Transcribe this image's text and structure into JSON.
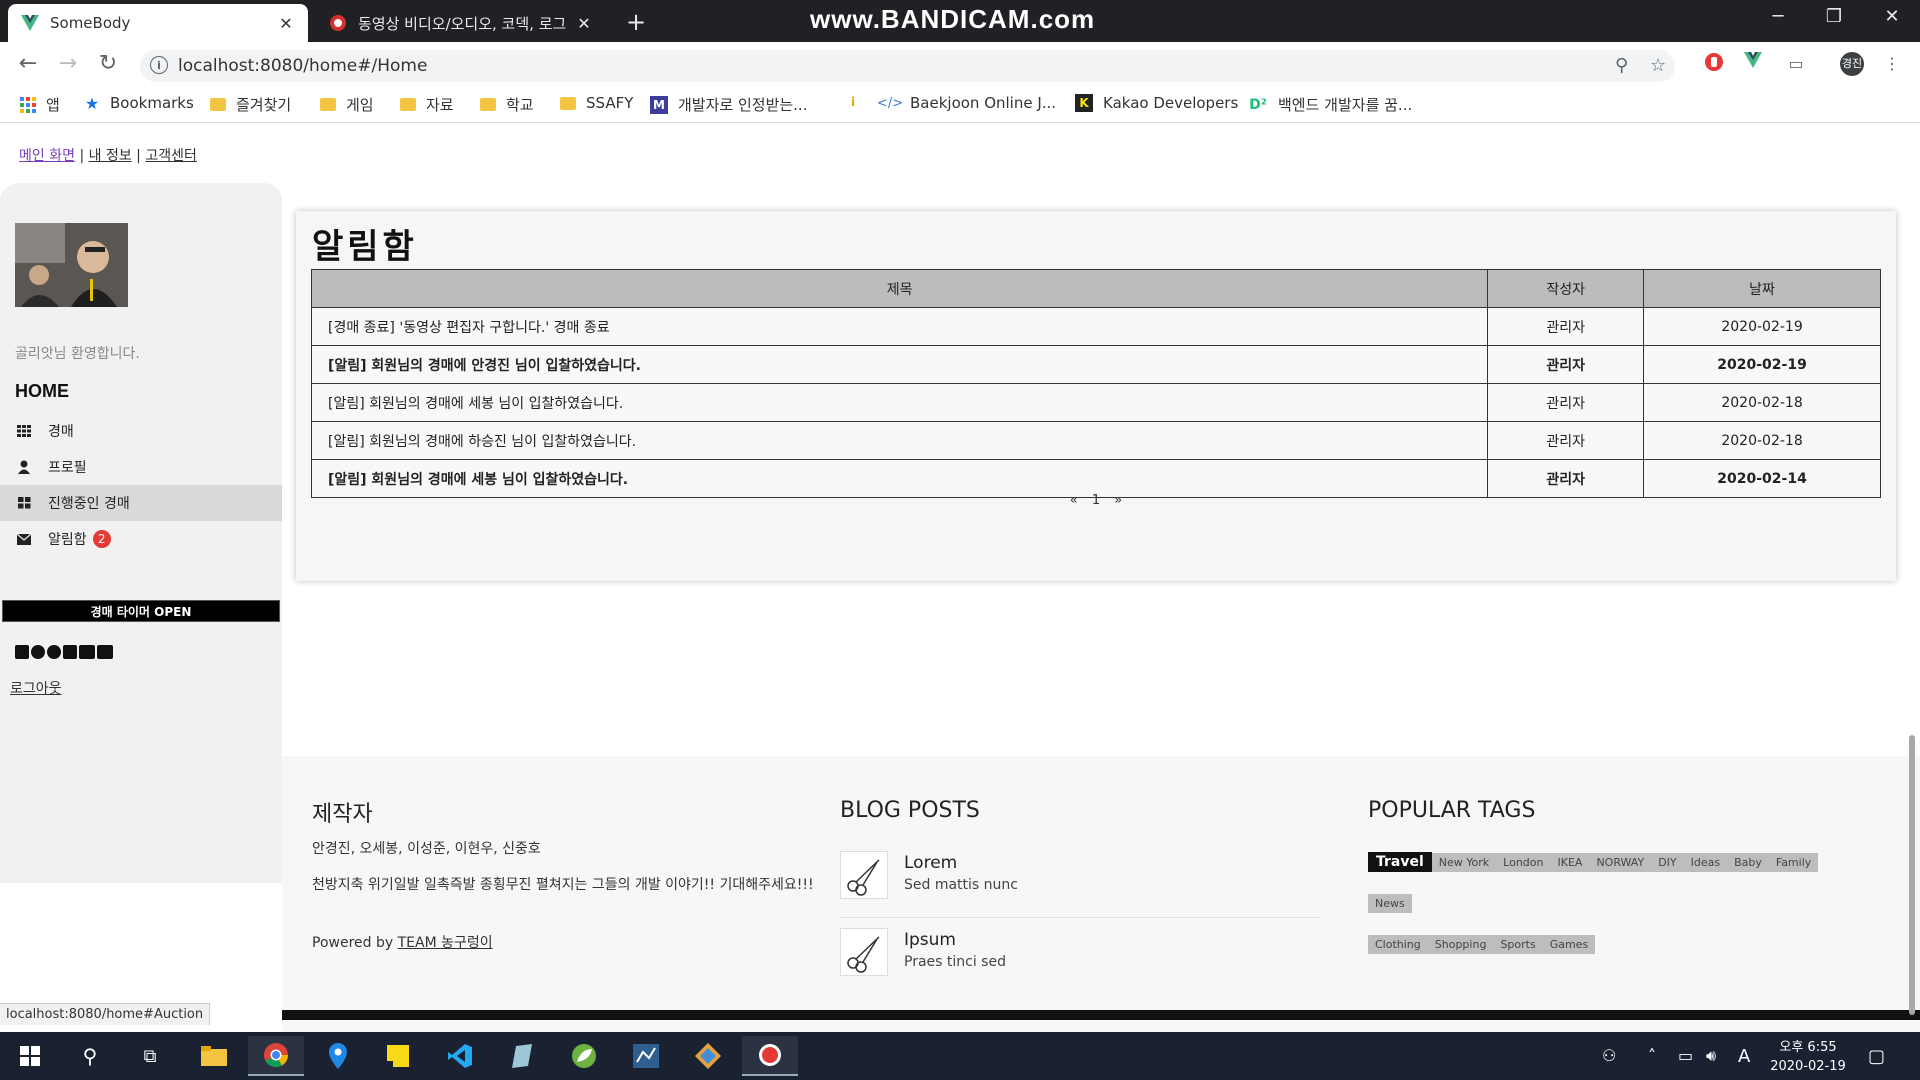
{
  "browser": {
    "tabs": [
      {
        "title": "SomeBody",
        "active": true
      },
      {
        "title": "동영상 비디오/오디오, 코덱, 로그",
        "active": false
      }
    ],
    "watermark": "www.BANDICAM.com",
    "url": "localhost:8080/home#/Home",
    "profile_label": "경진",
    "bookmarks": [
      "앱",
      "Bookmarks",
      "즐겨찾기",
      "게임",
      "자료",
      "학교",
      "SSAFY",
      "개발자로 인정받는...",
      "Baekjoon Online J...",
      "Kakao Developers",
      "백엔드 개발자를 꿈..."
    ]
  },
  "topnav": {
    "main": "메인 화면",
    "sep": "|",
    "myinfo": "내 정보",
    "support": "고객센터"
  },
  "sidebar": {
    "welcome": "골리앗님 환영합니다.",
    "home": "HOME",
    "items": [
      {
        "label": "경매",
        "icon": "grid-icon"
      },
      {
        "label": "프로필",
        "icon": "user-icon"
      },
      {
        "label": "진행중인 경매",
        "icon": "tiles-icon",
        "active": true
      },
      {
        "label": "알림함",
        "icon": "envelope-icon",
        "badge": "2"
      }
    ],
    "timer_button": "경매 타이머 OPEN",
    "logout": "로그아웃"
  },
  "main": {
    "title": "알림함",
    "columns": [
      "제목",
      "작성자",
      "날짜"
    ],
    "rows": [
      {
        "title": "[경매 종료] '동영상 편집자 구합니다.' 경매 종료",
        "author": "관리자",
        "date": "2020-02-19",
        "bold": false
      },
      {
        "title": "[알림] 회원님의 경매에 안경진 님이 입찰하였습니다.",
        "author": "관리자",
        "date": "2020-02-19",
        "bold": true
      },
      {
        "title": "[알림] 회원님의 경매에 세봉 님이 입찰하였습니다.",
        "author": "관리자",
        "date": "2020-02-18",
        "bold": false
      },
      {
        "title": "[알림] 회원님의 경매에 하승진 님이 입찰하였습니다.",
        "author": "관리자",
        "date": "2020-02-18",
        "bold": false
      },
      {
        "title": "[알림] 회원님의 경매에 세봉 님이 입찰하였습니다.",
        "author": "관리자",
        "date": "2020-02-14",
        "bold": true
      }
    ],
    "pager": {
      "prev": "«",
      "page": "1",
      "next": "»"
    }
  },
  "footer": {
    "makers_title": "제작자",
    "makers_names": "안경진, 오세봉, 이성준, 이현우, 신중호",
    "makers_desc": "천방지축 위기일발 일촉즉발 종횡무진 펼쳐지는 그들의 개발 이야기!! 기대해주세요!!!",
    "powered_prefix": "Powered by ",
    "powered_link": "TEAM 농구렁이",
    "blog_title": "BLOG POSTS",
    "posts": [
      {
        "title": "Lorem",
        "sub": "Sed mattis nunc"
      },
      {
        "title": "Ipsum",
        "sub": "Praes tinci sed"
      }
    ],
    "tags_title": "POPULAR TAGS",
    "tags": [
      "Travel",
      "New York",
      "London",
      "IKEA",
      "NORWAY",
      "DIY",
      "Ideas",
      "Baby",
      "Family",
      "News",
      "Clothing",
      "Shopping",
      "Sports",
      "Games"
    ]
  },
  "status_url": "localhost:8080/home#Auction",
  "taskbar": {
    "time": "오후 6:55",
    "date": "2020-02-19",
    "ime": "A"
  }
}
